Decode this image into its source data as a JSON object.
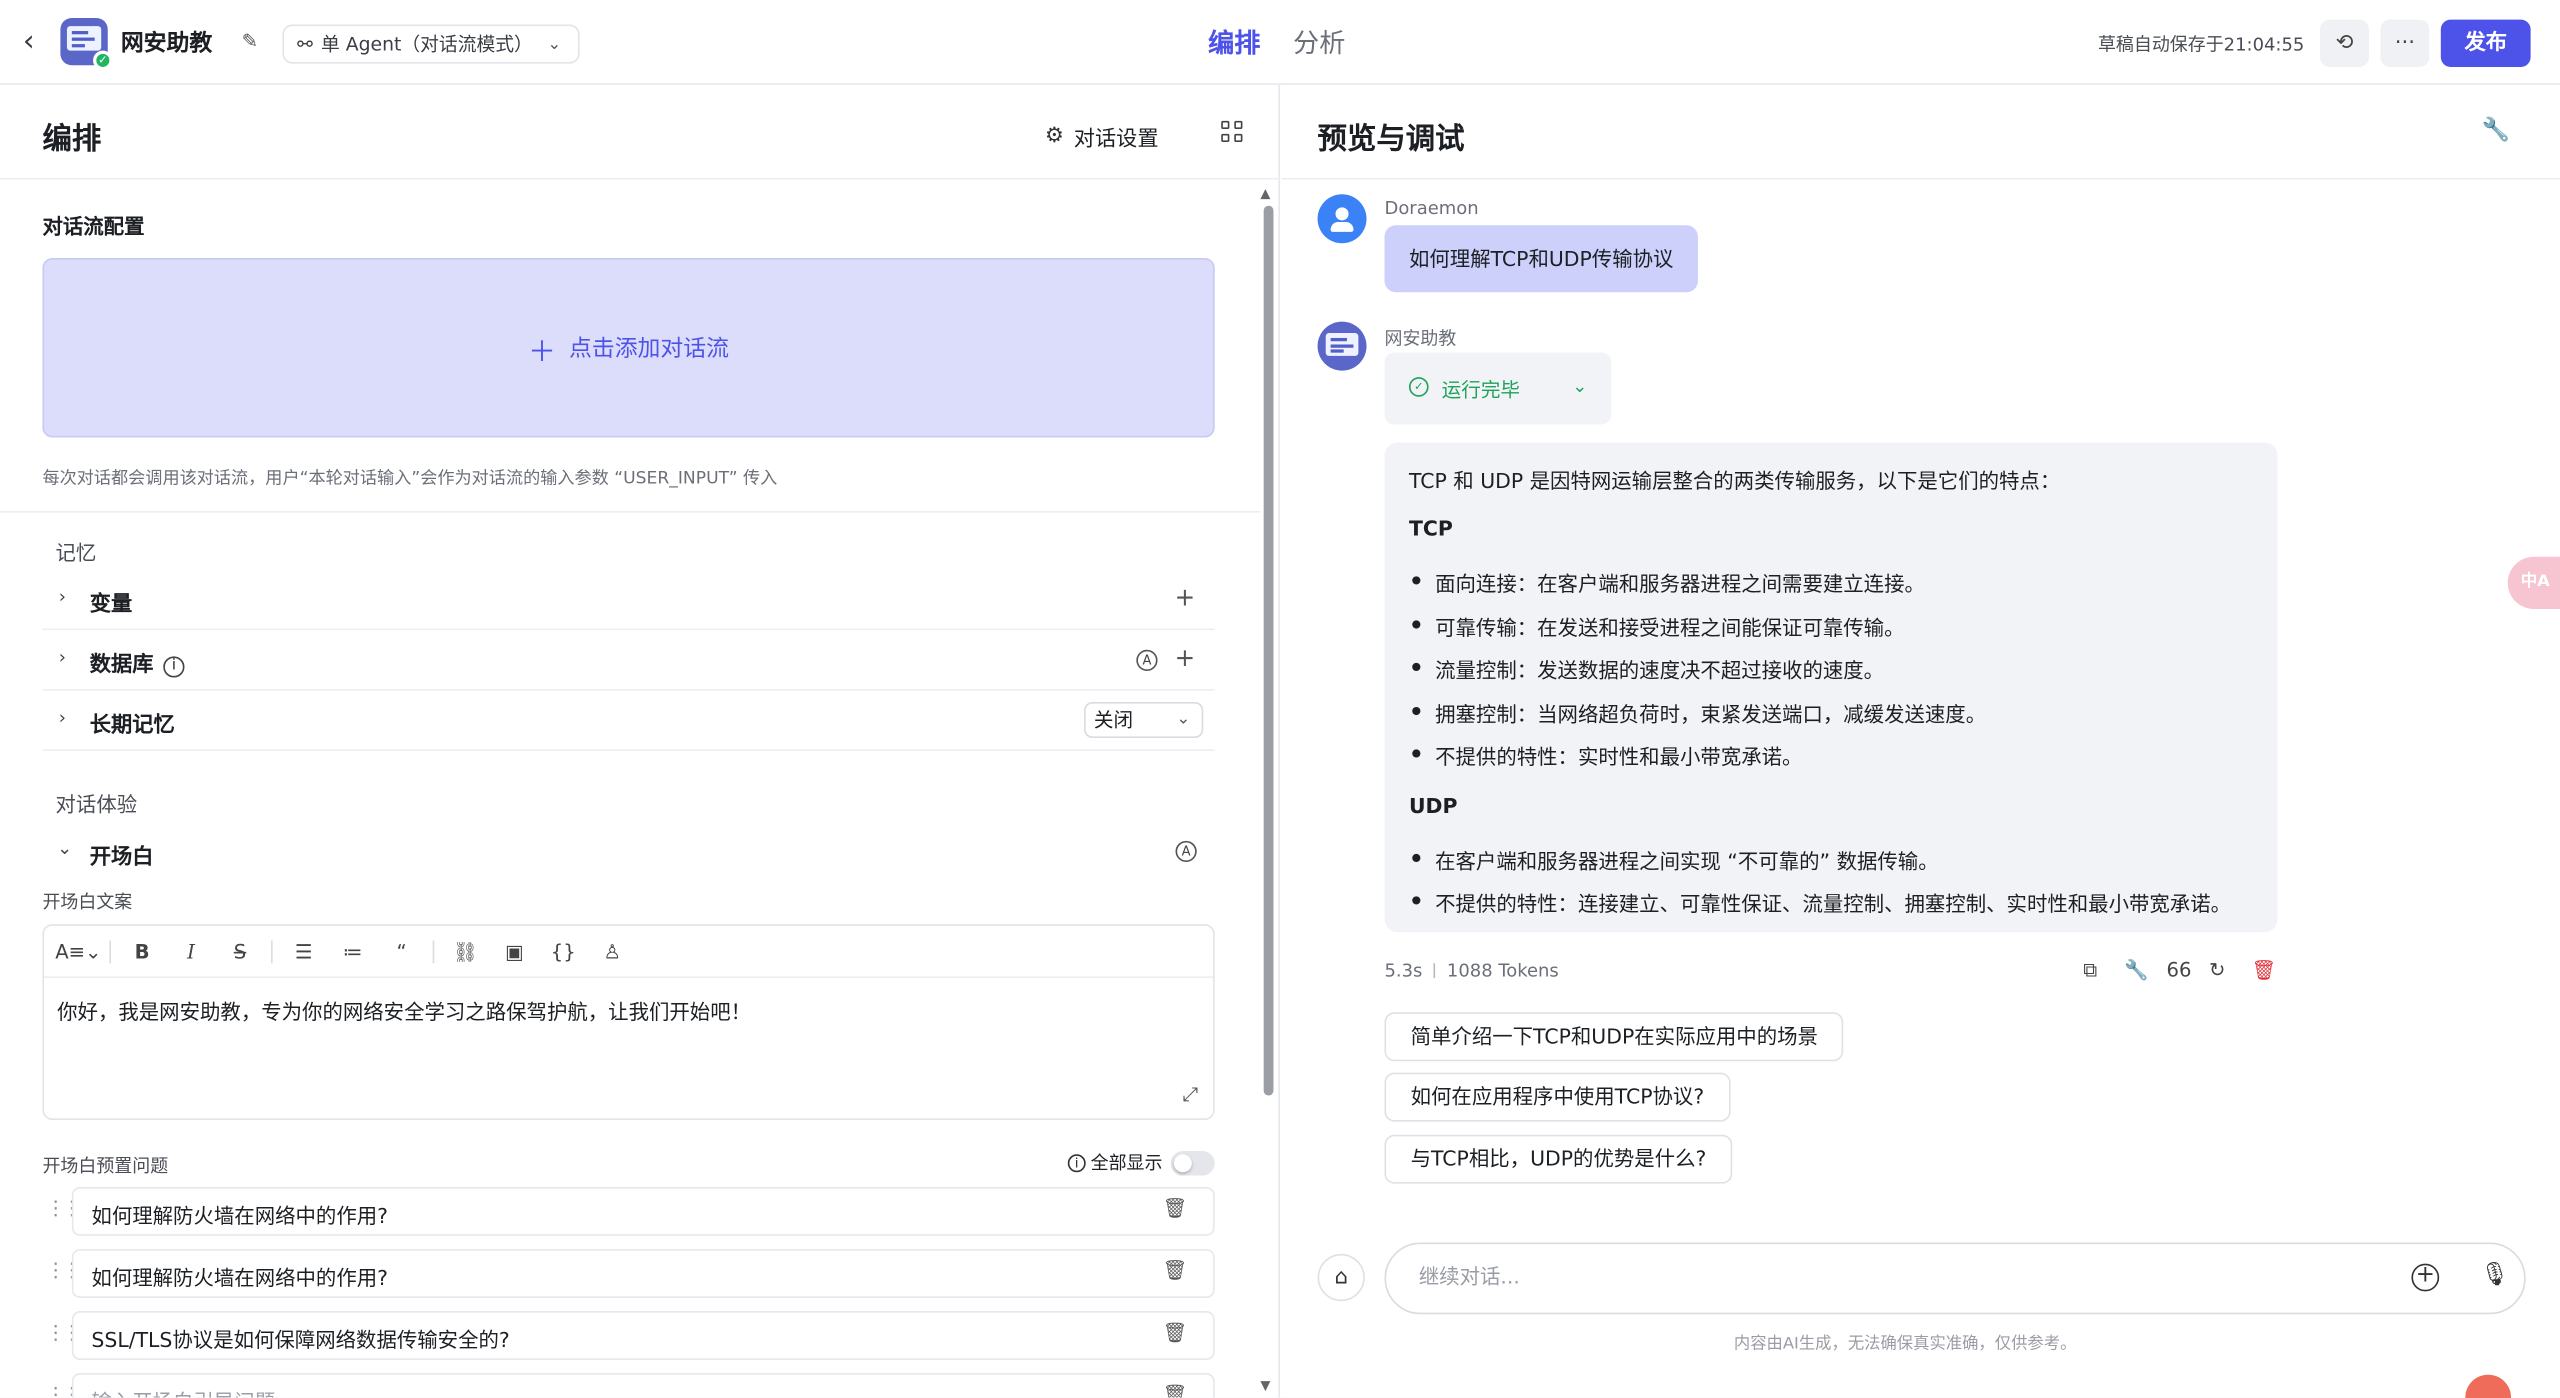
{
  "header": {
    "app_name": "网安助教",
    "mode_label": "单 Agent（对话流模式）",
    "tabs": [
      "编排",
      "分析"
    ],
    "save_status": "草稿自动保存于21:04:55",
    "publish_label": "发布"
  },
  "left": {
    "title": "编排",
    "dialog_settings": "对话设置",
    "flow_config_label": "对话流配置",
    "add_flow_label": "点击添加对话流",
    "flow_hint": "每次对话都会调用该对话流，用户“本轮对话输入”会作为对话流的输入参数 “USER_INPUT” 传入",
    "memory_title": "记忆",
    "memory_items": [
      "变量",
      "数据库",
      "长期记忆"
    ],
    "long_memory_value": "关闭",
    "experience_title": "对话体验",
    "opener_title": "开场白",
    "opener_text_label": "开场白文案",
    "opener_text": "你好，我是网安助教，专为你的网络安全学习之路保驾护航，让我们开始吧！",
    "preset_label": "开场白预置问题",
    "show_all_label": "全部显示",
    "preset_questions": [
      "如何理解防火墙在网络中的作用?",
      "如何理解防火墙在网络中的作用?",
      "SSL/TLS协议是如何保障网络数据传输安全的?"
    ],
    "preset_placeholder": "输入开场白引导问题"
  },
  "right": {
    "title": "预览与调试",
    "user_name": "Doraemon",
    "user_message": "如何理解TCP和UDP传输协议",
    "bot_name": "网安助教",
    "run_status": "运行完毕",
    "answer": {
      "intro": "TCP 和 UDP 是因特网运输层整合的两类传输服务，以下是它们的特点：",
      "tcp_heading": "TCP",
      "tcp_points": [
        "面向连接：在客户端和服务器进程之间需要建立连接。",
        "可靠传输：在发送和接受进程之间能保证可靠传输。",
        "流量控制：发送数据的速度决不超过接收的速度。",
        "拥塞控制：当网络超负荷时，束紧发送端口，减缓发送速度。",
        "不提供的特性：实时性和最小带宽承诺。"
      ],
      "udp_heading": "UDP",
      "udp_points": [
        "在客户端和服务器进程之间实现 “不可靠的” 数据传输。",
        "不提供的特性：连接建立、可靠性保证、流量控制、拥塞控制、实时性和最小带宽承诺。"
      ]
    },
    "latency": "5.3s",
    "tokens": "1088 Tokens",
    "suggestions": [
      "简单介绍一下TCP和UDP在实际应用中的场景",
      "如何在应用程序中使用TCP协议?",
      "与TCP相比，UDP的优势是什么?"
    ],
    "input_placeholder": "继续对话...",
    "disclaimer": "内容由AI生成，无法确保真实准确，仅供参考。"
  },
  "colors": {
    "accent": "#4d53e8",
    "success": "#1ea35a",
    "danger": "#e0323a"
  }
}
